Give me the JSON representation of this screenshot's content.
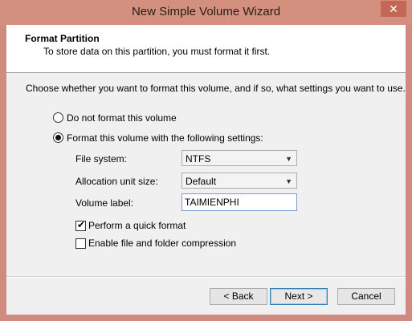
{
  "window": {
    "title": "New Simple Volume Wizard",
    "close_glyph": "✕"
  },
  "header": {
    "title": "Format Partition",
    "description": "To store data on this partition, you must format it first."
  },
  "instructions": "Choose whether you want to format this volume, and if so, what settings you want to use.",
  "options": {
    "no_format": {
      "label": "Do not format this volume",
      "selected": false
    },
    "format": {
      "label": "Format this volume with the following settings:",
      "selected": true
    }
  },
  "settings": {
    "file_system": {
      "label": "File system:",
      "value": "NTFS"
    },
    "allocation_unit": {
      "label": "Allocation unit size:",
      "value": "Default"
    },
    "volume_label": {
      "label": "Volume label:",
      "value": "TAIMIENPHI"
    }
  },
  "checks": {
    "quick_format": {
      "label": "Perform a quick format",
      "checked": true
    },
    "compression": {
      "label": "Enable file and folder compression",
      "checked": false
    }
  },
  "buttons": {
    "back": "< Back",
    "next": "Next >",
    "cancel": "Cancel"
  },
  "colors": {
    "title_bar": "#d3907f",
    "close_button": "#c46757",
    "dialog_bg": "#f0f0f0"
  }
}
